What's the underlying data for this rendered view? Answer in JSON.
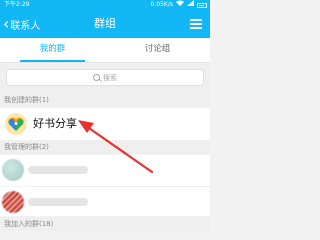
{
  "status_bar": {
    "time": "下午2:29",
    "network_speed": "0.05K/s"
  },
  "header": {
    "back_label": "联系人",
    "title": "群组"
  },
  "tabs": [
    {
      "label": "我的群",
      "active": true
    },
    {
      "label": "讨论组",
      "active": false
    }
  ],
  "search": {
    "placeholder": "搜索"
  },
  "sections": {
    "created": {
      "label": "我创建的群(1)"
    },
    "managed": {
      "label": "我管理的群(2)"
    },
    "joined": {
      "label": "我加入的群(18)"
    }
  },
  "created_groups": [
    {
      "name": "好书分享",
      "icon": "colorful-heart-icon"
    }
  ],
  "colors": {
    "accent": "#12b7f5",
    "arrow": "#e8322e"
  }
}
